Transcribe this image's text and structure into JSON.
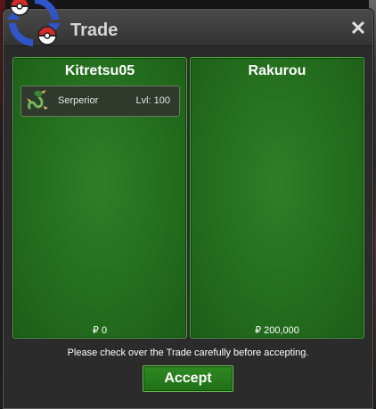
{
  "window": {
    "title": "Trade",
    "close_glyph": "✕"
  },
  "left_panel": {
    "trainer": "Kitretsu05",
    "items": [
      {
        "name": "Serperior",
        "level": "Lvl: 100",
        "icon": "serperior-sprite-icon"
      }
    ],
    "money": "₽ 0"
  },
  "right_panel": {
    "trainer": "Rakurou",
    "items": [],
    "money": "₽ 200,000"
  },
  "footer": {
    "notice": "Please check over the Trade carefully before accepting.",
    "accept_label": "Accept"
  },
  "colors": {
    "panel_green": "#246e1e",
    "panel_border": "#50a040",
    "button_green": "#2f8a22",
    "window_bg": "#2b2b2b"
  }
}
